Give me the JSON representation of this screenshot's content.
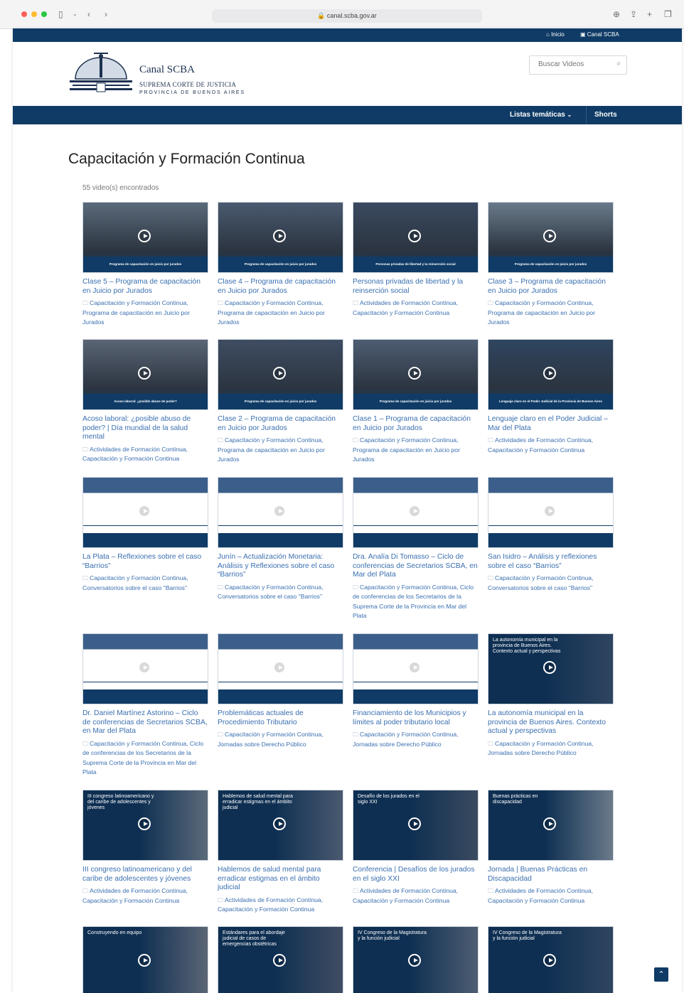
{
  "browser": {
    "url": "canal.scba.gov.ar"
  },
  "topstrip": {
    "home": "Inicio",
    "channel": "Canal SCBA"
  },
  "header": {
    "brand": "Canal SCBA",
    "sub1": "SUPREMA CORTE DE JUSTICIA",
    "sub2": "PROVINCIA DE BUENOS AIRES",
    "search_placeholder": "Buscar Videos"
  },
  "nav": {
    "lists": "Listas temáticas",
    "shorts": "Shorts"
  },
  "page": {
    "title": "Capacitación y Formación Continua",
    "count": "55 video(s) encontrados"
  },
  "cards": [
    {
      "title": "Clase 5 – Programa de capacitación en Juicio por Jurados",
      "cat1": "Capacitación y Formación Continua,",
      "cat2": "Programa de capacitación en Juicio por Jurados",
      "thumb_text": "Programa de capacitación en juicio por jurados"
    },
    {
      "title": "Clase 4 – Programa de capacitación en Juicio por Jurados",
      "cat1": "Capacitación y Formación Continua,",
      "cat2": "Programa de capacitación en Juicio por Jurados",
      "thumb_text": "Programa de capacitación en juicio por jurados"
    },
    {
      "title": "Personas privadas de libertad y la reinserción social",
      "cat1": "Actividades de Formación Continua,",
      "cat2": "Capacitación y Formación Continua",
      "thumb_text": "Personas privadas de libertad y la reinserción social"
    },
    {
      "title": "Clase 3 – Programa de capacitación en Juicio por Jurados",
      "cat1": "Capacitación y Formación Continua,",
      "cat2": "Programa de capacitación en Juicio por Jurados",
      "thumb_text": "Programa de capacitación en juicio por jurados"
    },
    {
      "title": "Acoso laboral: ¿posible abuso de poder? | Día mundial de la salud mental",
      "cat1": "Actividades de Formación Continua,",
      "cat2": "Capacitación y Formación Continua",
      "thumb_text": "Acoso laboral: ¿posible abuso de poder?"
    },
    {
      "title": "Clase 2 – Programa de capacitación en Juicio por Jurados",
      "cat1": "Capacitación y Formación Continua,",
      "cat2": "Programa de capacitación en Juicio por Jurados",
      "thumb_text": "Programa de capacitación en juicio por jurados"
    },
    {
      "title": "Clase 1 – Programa de capacitación en Juicio por Jurados",
      "cat1": "Capacitación y Formación Continua,",
      "cat2": "Programa de capacitación en Juicio por Jurados",
      "thumb_text": "Programa de capacitación en juicio por jurados"
    },
    {
      "title": "Lenguaje claro en el Poder Judicial – Mar del Plata",
      "cat1": "Actividades de Formación Continua,",
      "cat2": "Capacitación y Formación Continua",
      "thumb_text": "Lenguaje claro en el Poder Judicial de la Provincia de Buenos Aires"
    },
    {
      "title": "La Plata – Reflexiones sobre el caso “Barrios”",
      "cat1": "Capacitación y Formación Continua,",
      "cat2": "Conversatorios sobre el caso \"Barrios\"",
      "thumb_text": ""
    },
    {
      "title": "Junín – Actualización Monetaria: Análisis y Reflexiones sobre el caso “Barrios”",
      "cat1": "Capacitación y Formación Continua,",
      "cat2": "Conversatorios sobre el caso \"Barrios\"",
      "thumb_text": ""
    },
    {
      "title": "Dra. Analía Di Tomasso – Ciclo de conferencias de Secretarios SCBA, en Mar del Plata",
      "cat1": "Capacitación y Formación Continua,",
      "cat2": "Ciclo de conferencias de los Secretarios de la Suprema Corte de la Provincia en Mar del Plata",
      "thumb_text": ""
    },
    {
      "title": "San Isidro – Análisis y reflexiones sobre el caso “Barrios”",
      "cat1": "Capacitación y Formación Continua,",
      "cat2": "Conversatorios sobre el caso \"Barrios\"",
      "thumb_text": ""
    },
    {
      "title": "Dr. Daniel Martínez Astorino – Ciclo de conferencias de Secretarios SCBA, en Mar del Plata",
      "cat1": "Capacitación y Formación Continua,",
      "cat2": "Ciclo de conferencias de los Secretarios de la Suprema Corte de la Provincia en Mar del Plata",
      "thumb_text": ""
    },
    {
      "title": "Problemáticas actuales de Procedimiento Tributario",
      "cat1": "Capacitación y Formación Continua,",
      "cat2": "Jornadas sobre Derecho Público",
      "thumb_text": ""
    },
    {
      "title": "Financiamiento de los Municipios y límites al poder tributario local",
      "cat1": "Capacitación y Formación Continua,",
      "cat2": "Jornadas sobre Derecho Público",
      "thumb_text": ""
    },
    {
      "title": "La autonomía municipal en la provincia de Buenos Aires. Contexto actual y perspectivas",
      "cat1": "Capacitación y Formación Continua,",
      "cat2": "Jornadas sobre Derecho Público",
      "thumb_text": "La autonomía municipal en la provincia de Buenos Aires. Contexto actual y perspectivas"
    },
    {
      "title": "III congreso latinoamericano y del caribe de adolescentes y jóvenes",
      "cat1": "Actividades de Formación Continua,",
      "cat2": "Capacitación y Formación Continua",
      "thumb_text": "III congreso latinoamericano y del caribe de adolescentes y jóvenes"
    },
    {
      "title": "Hablemos de salud mental para erradicar estigmas en el ámbito judicial",
      "cat1": "Actividades de Formación Continua,",
      "cat2": "Capacitación y Formación Continua",
      "thumb_text": "Hablemos de salud mental para erradicar estigmas en el ámbito judicial"
    },
    {
      "title": "Conferencia | Desafíos de los jurados en el siglo XXI",
      "cat1": "Actividades de Formación Continua,",
      "cat2": "Capacitación y Formación Continua",
      "thumb_text": "Desafío de los jurados en el siglo XXI"
    },
    {
      "title": "Jornada | Buenas Prácticas en Discapacidad",
      "cat1": "Actividades de Formación Continua,",
      "cat2": "Capacitación y Formación Continua",
      "thumb_text": "Buenas prácticas en discapacidad"
    },
    {
      "title": "",
      "cat1": "",
      "cat2": "",
      "thumb_text": "Construyendo en equipo"
    },
    {
      "title": "",
      "cat1": "",
      "cat2": "",
      "thumb_text": "Estándares para el abordaje judicial de casos de emergencias obstétricas"
    },
    {
      "title": "",
      "cat1": "",
      "cat2": "",
      "thumb_text": "IV Congreso de la Magistratura y la función judicial"
    },
    {
      "title": "",
      "cat1": "",
      "cat2": "",
      "thumb_text": "IV Congreso de la Magistratura y la función judicial"
    }
  ]
}
